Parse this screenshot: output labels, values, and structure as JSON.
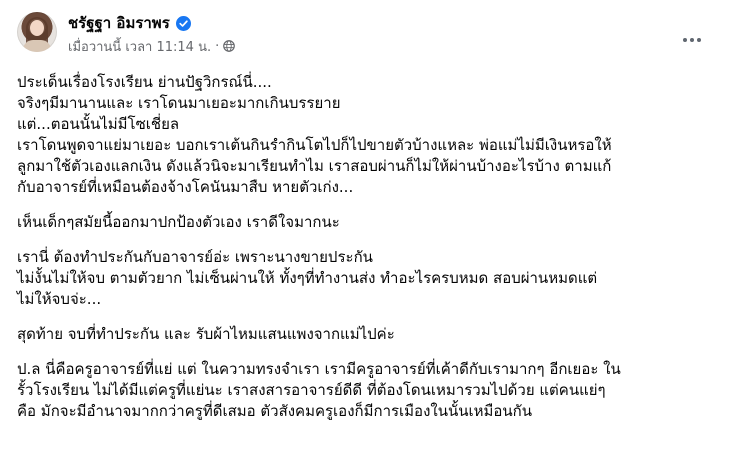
{
  "post": {
    "author": "ชรัฐฐา อิมราพร",
    "verified_icon": "verified-badge-icon",
    "timestamp": "เมื่อวานนี้ เวลา 11:14 น.",
    "separator": "·",
    "audience_icon": "globe-icon",
    "more_icon": "more-options-icon",
    "paragraphs": [
      [
        "ประเด็นเรื่องโรงเรียน ย่านปัฐวิกรณ์นี่....",
        "จริงๆมีมานานและ เราโดนมาเยอะมากเกินบรรยาย",
        "แต่...ตอนนั้นไม่มีโซเชี่ยล",
        "เราโดนพูดจาแย่มาเยอะ บอกเราเต้นกินรำกินโตไปก็ไปขายตัวบ้างแหละ พ่อแม่ไม่มีเงินหรอให้",
        "ลูกมาใช้ตัวเองแลกเงิน ดังแล้วนิจะมาเรียนทำไม เราสอบผ่านก็ไม่ให้ผ่านบ้างอะไรบ้าง ตามแก้",
        "กับอาจารย์ที่เหมือนต้องจ้างโคนันมาสืบ หายตัวเก่ง..."
      ],
      [
        "เห็นเด็กๆสมัยนี้ออกมาปกป้องตัวเอง เราดีใจมากนะ"
      ],
      [
        "เรานี่ ต้องทำประกันกับอาจารย์อ่ะ เพราะนางขายประกัน",
        "ไม่งั้นไม่ให้จบ ตามตัวยาก ไม่เซ็นผ่านให้ ทั้งๆที่ทำงานส่ง ทำอะไรครบหมด สอบผ่านหมดแต่",
        "ไม่ให้จบจ่ะ..."
      ],
      [
        "สุดท้าย จบที่ทำประกัน และ รับผ้าไหมแสนแพงจากแม่ไปค่ะ"
      ],
      [
        "ป.ล นี่คือครูอาจารย์ที่แย่ แต่ ในความทรงจำเรา เรามีครูอาจารย์ที่เค้าดีกับเรามากๆ อีกเยอะ ใน",
        "รั้วโรงเรียน ไม่ได้มีแต่ครูที่แย่นะ เราสงสารอาจารย์ดีดี ที่ต้องโดนเหมารวมไปด้วย แต่คนแย่ๆ",
        "คือ มักจะมีอำนาจมากกว่าครูที่ดีเสมอ ตัวสังคมครูเองก็มีการเมืองในนั้นเหมือนกัน"
      ]
    ]
  }
}
